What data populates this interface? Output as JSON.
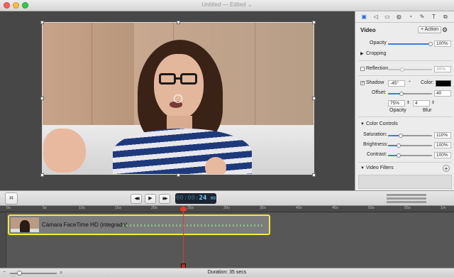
{
  "window": {
    "title": "Untitled",
    "title_sep": " — ",
    "status": "Edited",
    "status_chevron": "⌄",
    "traffic_colors": [
      "#fc605b",
      "#fdbc40",
      "#34c84a"
    ]
  },
  "inspector": {
    "tabs": [
      {
        "icon": "video-tab-icon",
        "glyph": "▣",
        "active": true
      },
      {
        "icon": "audio-tab-icon",
        "glyph": "◁"
      },
      {
        "icon": "screen-tab-icon",
        "glyph": "▭"
      },
      {
        "icon": "callout-tab-icon",
        "glyph": "◍"
      },
      {
        "icon": "cursor-tab-icon",
        "glyph": "◔"
      },
      {
        "icon": "pen-tab-icon",
        "glyph": "✎"
      },
      {
        "icon": "text-tab-icon",
        "glyph": "T"
      },
      {
        "icon": "info-tab-icon",
        "glyph": "⧉"
      }
    ],
    "section_title": "Video",
    "action_label": "+ Action",
    "gear_glyph": "⚙",
    "opacity": {
      "label": "Opacity",
      "value": "100%",
      "level": 1.0
    },
    "cropping_label": "Cropping",
    "reflection": {
      "label": "Reflection",
      "value": "30%",
      "checked": false,
      "level": 0.3
    },
    "shadow": {
      "label": "Shadow",
      "checked": true,
      "angle": "-45°",
      "color_label": "Color:",
      "offset_label": "Offset:",
      "offset_value": "40",
      "opacity_value": "75%",
      "blur_value": "4",
      "opacity_caption": "Opacity",
      "blur_caption": "Blur",
      "color": "#000000"
    },
    "color_controls_label": "Color Controls",
    "saturation": {
      "label": "Saturation:",
      "value": "110%",
      "level": 0.55
    },
    "brightness": {
      "label": "Brightness:",
      "value": "100%",
      "level": 0.5
    },
    "contrast": {
      "label": "Contrast:",
      "value": "100%",
      "level": 0.5
    },
    "video_filters_label": "Video Filters",
    "add_filter_glyph": "+"
  },
  "toolbar": {
    "crop_glyph": "⌗",
    "rewind_glyph": "◀◀",
    "play_glyph": "▶",
    "forward_glyph": "▶▶",
    "timecode_dim": "00:00:",
    "timecode_sec": "24",
    "timecode_frames": "00"
  },
  "timeline": {
    "ruler_ticks": [
      "0s",
      "5s",
      "10s",
      "15s",
      "20s",
      "25s",
      "30s",
      "35s",
      "40s",
      "45s",
      "50s",
      "55s",
      "1m"
    ],
    "clip_name": "Cámara FaceTime HD (integrada)",
    "clip_border_color": "#f5e83a",
    "playhead_color": "#e53a2a",
    "playhead_seconds": 24
  },
  "status": {
    "duration": "Duration: 35 secs",
    "zoom_icon": "magnifier-icon"
  }
}
